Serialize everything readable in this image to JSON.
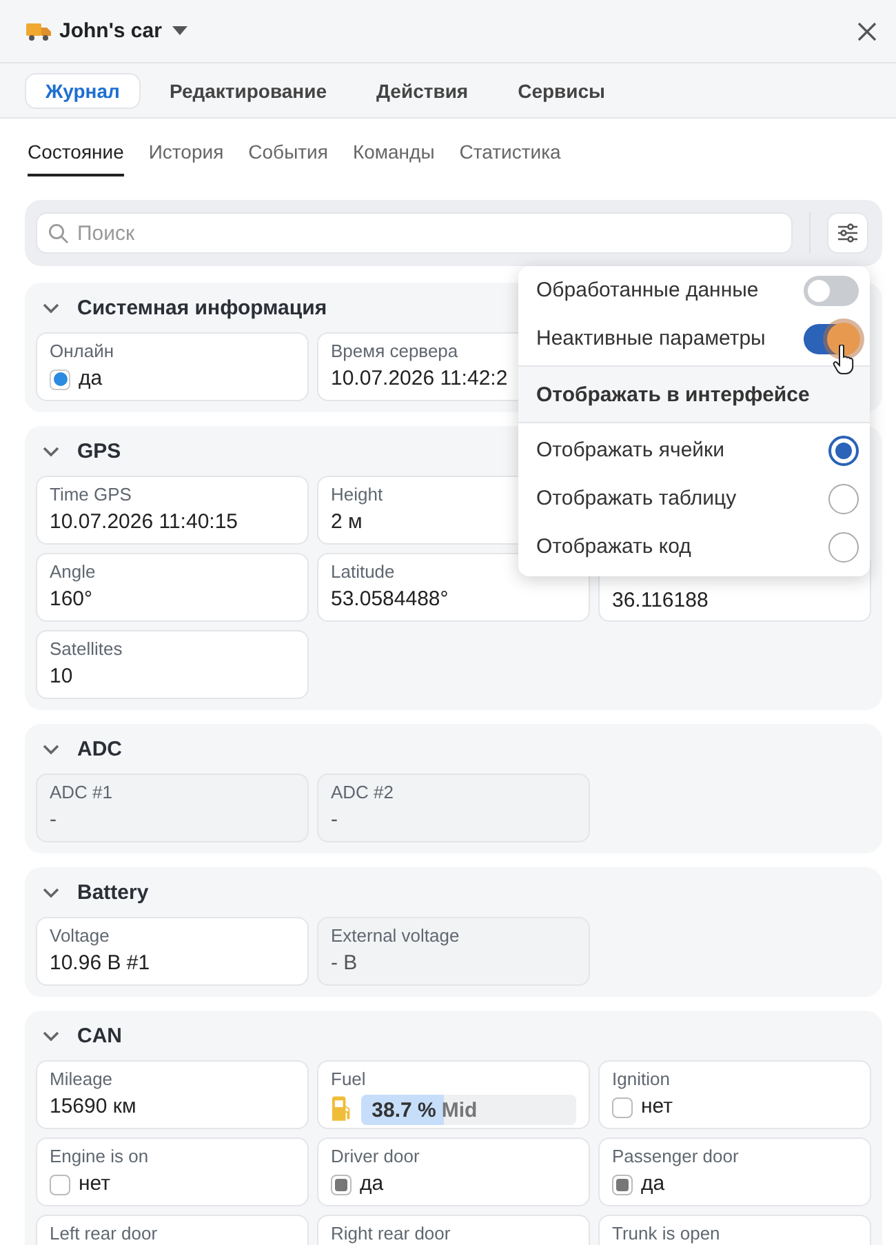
{
  "header": {
    "title": "John's car"
  },
  "tabs": [
    {
      "label": "Журнал",
      "selected": true
    },
    {
      "label": "Редактирование",
      "selected": false
    },
    {
      "label": "Действия",
      "selected": false
    },
    {
      "label": "Сервисы",
      "selected": false
    }
  ],
  "subtabs": [
    {
      "label": "Состояние",
      "selected": true
    },
    {
      "label": "История",
      "selected": false
    },
    {
      "label": "События",
      "selected": false
    },
    {
      "label": "Команды",
      "selected": false
    },
    {
      "label": "Статистика",
      "selected": false
    }
  ],
  "search": {
    "placeholder": "Поиск"
  },
  "sections": [
    {
      "title": "Системная информация",
      "expanded": true,
      "rows": [
        [
          {
            "label": "Онлайн",
            "value": "да",
            "kind": "dot",
            "checked": true,
            "inactive": false
          },
          {
            "label": "Время сервера",
            "value": "10.07.2026 11:42:2",
            "kind": "text",
            "inactive": false
          }
        ]
      ]
    },
    {
      "title": "GPS",
      "expanded": true,
      "rows": [
        [
          {
            "label": "Time GPS",
            "value": "10.07.2026 11:40:15",
            "kind": "text",
            "inactive": false
          },
          {
            "label": "Height",
            "value": "2 м",
            "kind": "text",
            "inactive": false
          }
        ],
        [
          {
            "label": "Angle",
            "value": "160°",
            "kind": "text",
            "inactive": false
          },
          {
            "label": "Latitude",
            "value": "53.0584488°",
            "kind": "text",
            "inactive": false
          },
          {
            "value": "36.116188",
            "kind": "text",
            "inactive": false
          }
        ],
        [
          {
            "label": "Satellites",
            "value": "10",
            "kind": "text",
            "inactive": false
          }
        ]
      ]
    },
    {
      "title": "ADC",
      "expanded": true,
      "rows": [
        [
          {
            "label": "ADC #1",
            "value": "-",
            "kind": "text",
            "inactive": true
          },
          {
            "label": "ADC #2",
            "value": "-",
            "kind": "text",
            "inactive": true
          }
        ]
      ]
    },
    {
      "title": "Battery",
      "expanded": true,
      "rows": [
        [
          {
            "label": "Voltage",
            "value": "10.96 В #1",
            "kind": "text",
            "inactive": false
          },
          {
            "label": "External voltage",
            "value": "- В",
            "kind": "text",
            "inactive": true
          }
        ]
      ]
    },
    {
      "title": "CAN",
      "expanded": true,
      "rows": [
        [
          {
            "label": "Mileage",
            "value": "15690 км",
            "kind": "text",
            "inactive": false
          },
          {
            "label": "Fuel",
            "value": "38.7 %",
            "note": "Mid",
            "kind": "fuel",
            "level": 0.387,
            "inactive": false
          },
          {
            "label": "Ignition",
            "value": "нет",
            "kind": "checkbox",
            "checked": false,
            "inactive": false
          }
        ],
        [
          {
            "label": "Engine is on",
            "value": "нет",
            "kind": "checkbox",
            "checked": false,
            "inactive": false
          },
          {
            "label": "Driver door",
            "value": "да",
            "kind": "checkbox",
            "checked": true,
            "inactive": false
          },
          {
            "label": "Passenger door",
            "value": "да",
            "kind": "checkbox",
            "checked": true,
            "inactive": false
          }
        ],
        [
          {
            "label": "Left rear door",
            "kind": "text",
            "inactive": false
          },
          {
            "label": "Right rear door",
            "kind": "text",
            "inactive": false
          },
          {
            "label": "Trunk is open",
            "kind": "text",
            "inactive": false
          }
        ]
      ]
    }
  ],
  "popup": {
    "toggles": [
      {
        "label": "Обработанные данные",
        "on": false
      },
      {
        "label": "Неактивные параметры",
        "on": true
      }
    ],
    "heading": "Отображать в интерфейсе",
    "options": [
      {
        "label": "Отображать ячейки",
        "selected": true
      },
      {
        "label": "Отображать таблицу",
        "selected": false
      },
      {
        "label": "Отображать код",
        "selected": false
      }
    ]
  }
}
